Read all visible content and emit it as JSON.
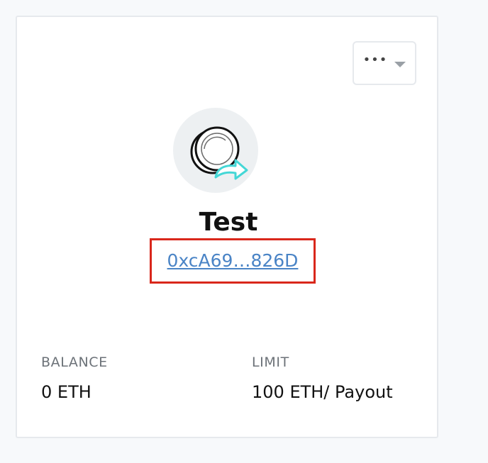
{
  "wallet": {
    "name": "Test",
    "address": "0xcA69…826D",
    "balance_label": "BALANCE",
    "balance_value": "0 ETH",
    "limit_label": "LIMIT",
    "limit_value": "100 ETH/ Payout"
  },
  "menu": {
    "dots": "•••",
    "icon": "chevron-down-icon"
  },
  "avatar": {
    "icon": "coin-transfer-icon",
    "accent_color": "#44d7d6"
  },
  "colors": {
    "highlight_border": "#d9271b",
    "link": "#4a84c6"
  }
}
